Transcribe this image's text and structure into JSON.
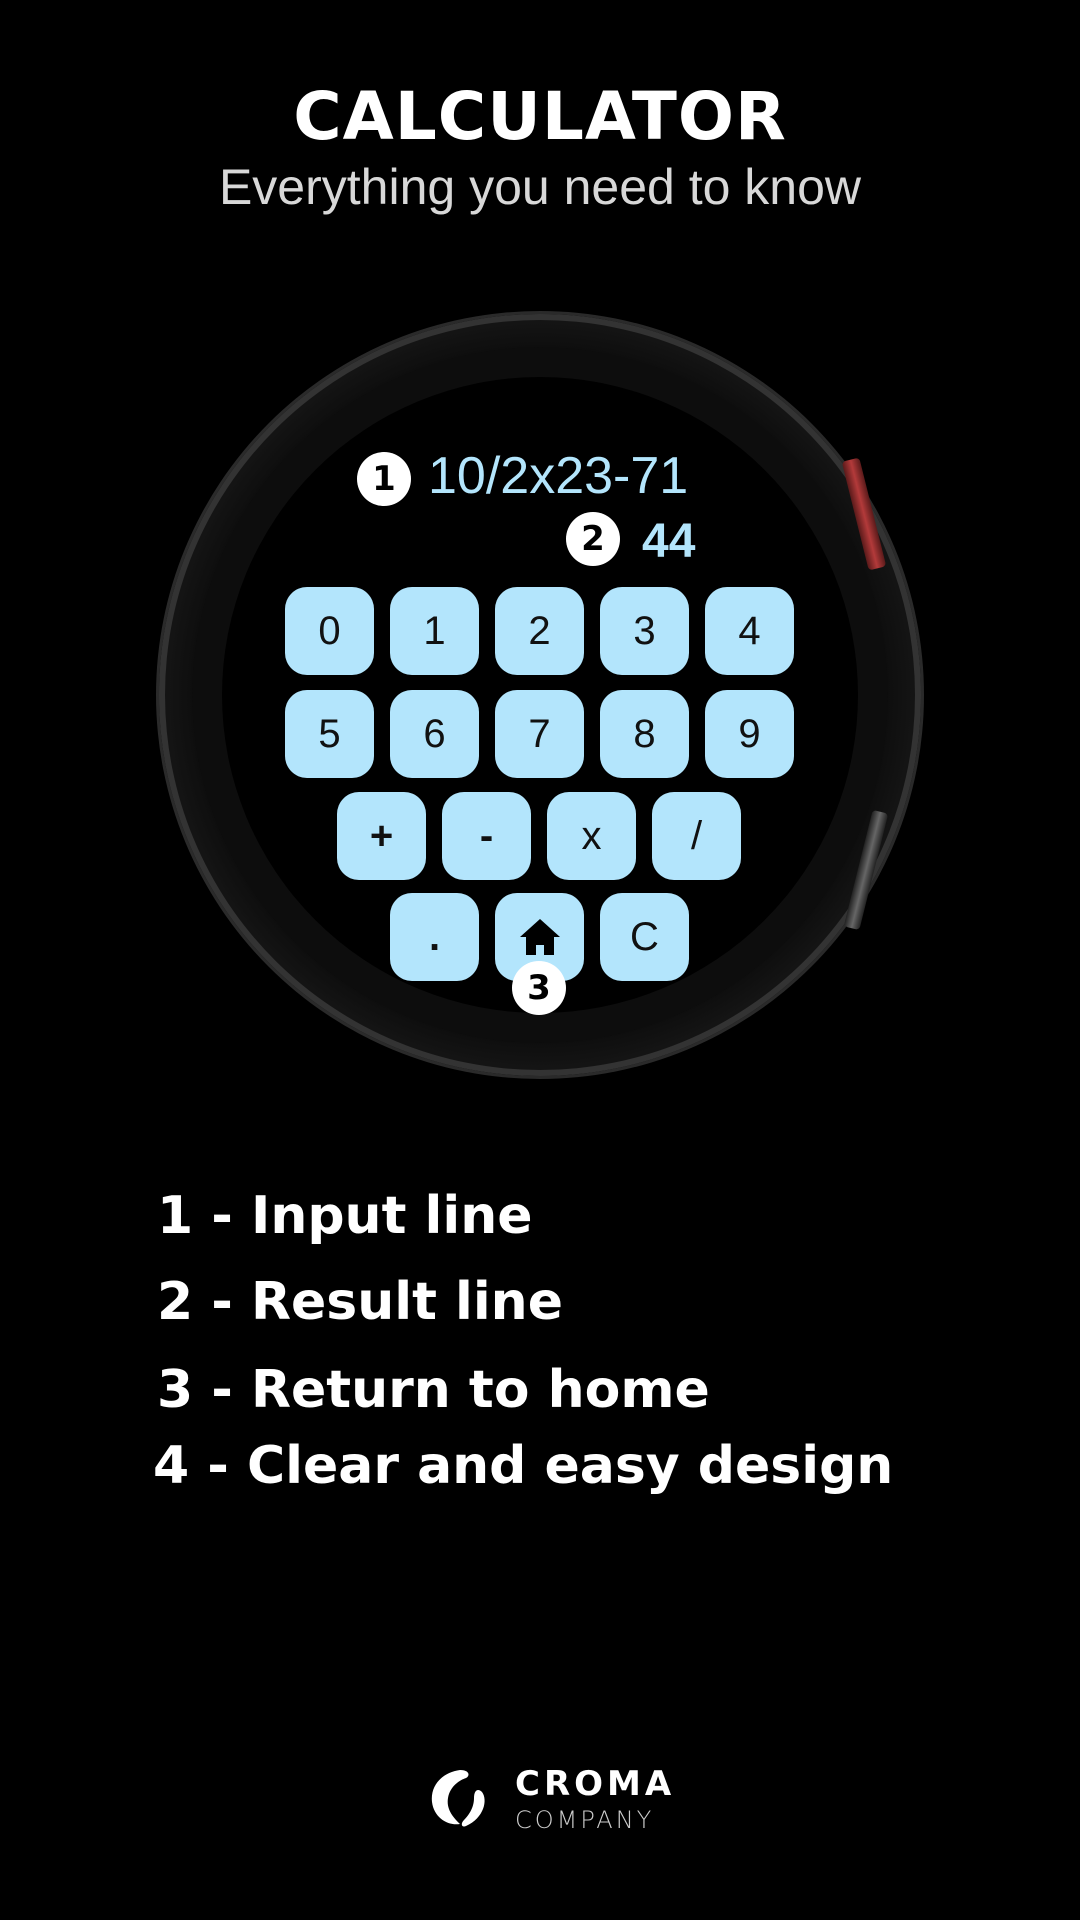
{
  "header": {
    "title": "CALCULATOR",
    "subtitle": "Everything you need to know"
  },
  "watch": {
    "input_line": "10/2x23-71",
    "result_line": "44",
    "badges": [
      "1",
      "2",
      "3"
    ],
    "keys": {
      "row1": [
        "0",
        "1",
        "2",
        "3",
        "4"
      ],
      "row2": [
        "5",
        "6",
        "7",
        "8",
        "9"
      ],
      "row3": [
        "+",
        "-",
        "x",
        "/"
      ],
      "row4": [
        ".",
        "home-icon",
        "C"
      ]
    },
    "key_color": "#b3e5fc",
    "text_color": "#b3e5fc"
  },
  "features": [
    "1 - Input line",
    "2 - Result line",
    "3 - Return to home",
    "4 - Clear and easy design"
  ],
  "footer": {
    "brand": "CROMA",
    "brand_sub": "COMPANY"
  }
}
